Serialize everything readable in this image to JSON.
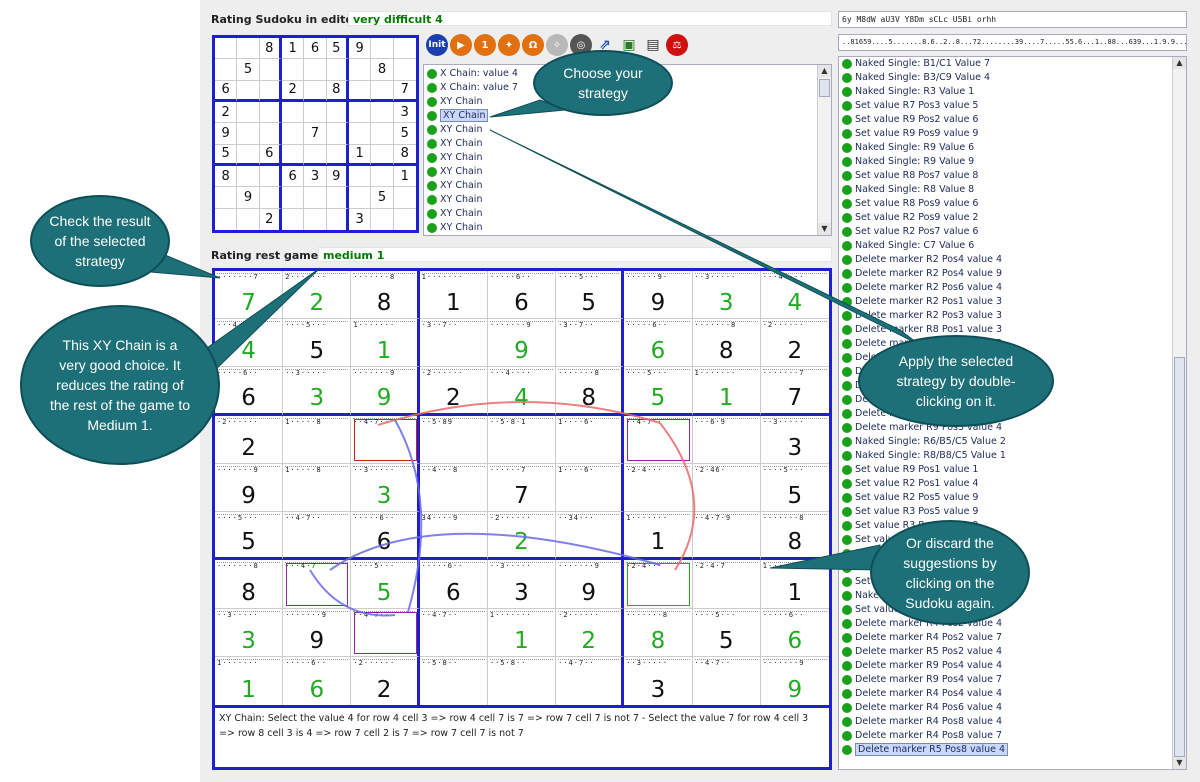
{
  "editor": {
    "rating_label": "Rating Sudoku in editor:",
    "rating_value": "very difficult 4"
  },
  "rest": {
    "rating_label": "Rating rest game:",
    "rating_value": "medium 1"
  },
  "top_inputs": {
    "code1": "6y M8dW aU3V Y8Dm sCLc U5Bi orhh",
    "code2": "..81659....5.......8.6..2..8...72........39....7.....55.6...1..88...639...1.9.9...."
  },
  "toolbar": {
    "init_label": "Init",
    "icons": [
      "init-icon",
      "play-icon",
      "one-step-icon",
      "runner-icon",
      "omega-icon",
      "walker-icon",
      "globe-icon",
      "export-icon",
      "camera-icon",
      "print-icon",
      "scale-icon"
    ]
  },
  "strategies": [
    "X Chain: value 4",
    "X Chain: value 7",
    "XY Chain",
    "XY Chain",
    "XY Chain",
    "XY Chain",
    "XY Chain",
    "XY Chain",
    "XY Chain",
    "XY Chain",
    "XY Chain",
    "XY Chain",
    "XY Chain"
  ],
  "selected_strategy_index": 3,
  "small_grid": [
    [
      "",
      "",
      "8",
      "1",
      "6",
      "5",
      "9",
      "",
      ""
    ],
    [
      "",
      "5",
      "",
      "",
      "",
      "",
      "",
      "8",
      ""
    ],
    [
      "6",
      "",
      "",
      "2",
      "",
      "8",
      "",
      "",
      "7"
    ],
    [
      "2",
      "",
      "",
      "",
      "",
      "",
      "",
      "",
      "3"
    ],
    [
      "9",
      "",
      "",
      "",
      "7",
      "",
      "",
      "",
      "5"
    ],
    [
      "5",
      "",
      "6",
      "",
      "",
      "",
      "1",
      "",
      "8"
    ],
    [
      "8",
      "",
      "",
      "6",
      "3",
      "9",
      "",
      "",
      "1"
    ],
    [
      "",
      "9",
      "",
      "",
      "",
      "",
      "",
      "5",
      ""
    ],
    [
      "",
      "",
      "2",
      "",
      "",
      "",
      "3",
      "",
      ""
    ]
  ],
  "big_grid": [
    [
      [
        "7",
        "g",
        "·······7"
      ],
      [
        "2",
        "g",
        "2·······"
      ],
      [
        "8",
        "k",
        "·······8"
      ],
      [
        "1",
        "k",
        "1·······"
      ],
      [
        "6",
        "k",
        "·····6··"
      ],
      [
        "5",
        "k",
        "····5···"
      ],
      [
        "9",
        "k",
        "······9·"
      ],
      [
        "3",
        "g",
        "··3·····"
      ],
      [
        "4",
        "g",
        "···4····"
      ]
    ],
    [
      [
        "4",
        "g",
        "···4····"
      ],
      [
        "5",
        "k",
        "····5···"
      ],
      [
        "1",
        "g",
        "1·······"
      ],
      [
        "",
        "k",
        "·3··7··"
      ],
      [
        "9",
        "g",
        "·······9"
      ],
      [
        "",
        "k",
        "·3··7··"
      ],
      [
        "6",
        "g",
        "·····6··"
      ],
      [
        "8",
        "k",
        "·······8"
      ],
      [
        "2",
        "k",
        "·2······"
      ]
    ],
    [
      [
        "6",
        "k",
        "·····6··"
      ],
      [
        "3",
        "g",
        "··3·····"
      ],
      [
        "9",
        "g",
        "·······9"
      ],
      [
        "2",
        "k",
        "·2······"
      ],
      [
        "4",
        "g",
        "···4····"
      ],
      [
        "8",
        "k",
        "·······8"
      ],
      [
        "5",
        "g",
        "····5···"
      ],
      [
        "1",
        "g",
        "1·······"
      ],
      [
        "7",
        "k",
        "·······7"
      ]
    ],
    [
      [
        "2",
        "k",
        "·2······"
      ],
      [
        "",
        "k",
        "1·····8"
      ],
      [
        "",
        "k",
        "··4·7··"
      ],
      [
        "",
        "k",
        "··5·89"
      ],
      [
        "",
        "k",
        "··5·8·1"
      ],
      [
        "",
        "k",
        "1····6·"
      ],
      [
        "",
        "k",
        "··4·7··"
      ],
      [
        "",
        "k",
        "···6·9"
      ],
      [
        "3",
        "k",
        "··3·····"
      ]
    ],
    [
      [
        "9",
        "k",
        "·······9"
      ],
      [
        "",
        "k",
        "1·····8"
      ],
      [
        "3",
        "g",
        "··3·····"
      ],
      [
        "",
        "k",
        "··4···8"
      ],
      [
        "7",
        "k",
        "······7"
      ],
      [
        "",
        "k",
        "1····6·"
      ],
      [
        "",
        "k",
        "·2·4···"
      ],
      [
        "",
        "k",
        "·2·46·"
      ],
      [
        "5",
        "k",
        "····5···"
      ]
    ],
    [
      [
        "5",
        "k",
        "····5···"
      ],
      [
        "",
        "k",
        "··4·7··"
      ],
      [
        "6",
        "k",
        "·····6··"
      ],
      [
        "",
        "k",
        "34····9"
      ],
      [
        "2",
        "g",
        "·2······"
      ],
      [
        "",
        "k",
        "··34···"
      ],
      [
        "1",
        "k",
        "1·······"
      ],
      [
        "",
        "k",
        "··4·7·9"
      ],
      [
        "8",
        "k",
        "·······8"
      ]
    ],
    [
      [
        "8",
        "k",
        "·······8"
      ],
      [
        "",
        "k",
        "···4·7"
      ],
      [
        "5",
        "g",
        "····5···"
      ],
      [
        "6",
        "k",
        "·····6··"
      ],
      [
        "3",
        "k",
        "··3·····"
      ],
      [
        "9",
        "k",
        "·······9"
      ],
      [
        "",
        "k",
        "·2·4···"
      ],
      [
        "",
        "k",
        "·2·4·7"
      ],
      [
        "1",
        "k",
        "1·······"
      ]
    ],
    [
      [
        "3",
        "g",
        "··3·····"
      ],
      [
        "9",
        "k",
        "·······9"
      ],
      [
        "",
        "k",
        "··4·7··"
      ],
      [
        "",
        "k",
        "··4·7··"
      ],
      [
        "1",
        "g",
        "1·······"
      ],
      [
        "2",
        "g",
        "·2······"
      ],
      [
        "8",
        "g",
        "·······8"
      ],
      [
        "5",
        "k",
        "····5···"
      ],
      [
        "6",
        "g",
        "·····6··"
      ]
    ],
    [
      [
        "1",
        "g",
        "1·······"
      ],
      [
        "6",
        "g",
        "·····6··"
      ],
      [
        "2",
        "k",
        "·2······"
      ],
      [
        "",
        "k",
        "··5·8··"
      ],
      [
        "",
        "k",
        "··5·8··"
      ],
      [
        "",
        "k",
        "··4·7··"
      ],
      [
        "3",
        "k",
        "··3·····"
      ],
      [
        "",
        "k",
        "··4·7··"
      ],
      [
        "9",
        "g",
        "·······9"
      ]
    ]
  ],
  "explanation": "XY Chain: Select the value 4 for row 4 cell 3 => row 4 cell 7 is 7 => row 7 cell 7 is not 7 - Select the value 7 for row 4 cell 3 => row 8 cell 3 is 4 => row 7 cell 2 is 7 => row 7 cell 7 is not 7",
  "steps": [
    "Naked Single: B1/C1 Value 7",
    "Naked Single: B3/C9 Value 4",
    "Naked Single: R3 Value 1",
    "Set value R7 Pos3 value 5",
    "Set value R9 Pos2 value 6",
    "Set value R9 Pos9 value 9",
    "Naked Single: R9 Value 6",
    "Naked Single: R9 Value 9",
    "Set value R8 Pos7 value 8",
    "Naked Single: R8 Value 8",
    "Set value R8 Pos9 value 6",
    "Set value R2 Pos9 value 2",
    "Set value R2 Pos7 value 6",
    "Naked Single: C7 Value 6",
    "Delete marker R2 Pos4 value 4",
    "Delete marker R2 Pos4 value 9",
    "Delete marker R2 Pos6 value 4",
    "Delete marker R2 Pos1 value 3",
    "Delete marker R2 Pos3 value 3",
    "Delete marker R8 Pos1 value 3",
    "Delete marker R8 Pos1 value 3",
    "Delete marker R8 Pos1 value 3",
    "Delete marker R8 Pos1 value 3",
    "Delete marker R8 Pos1 value 3",
    "Delete marker R8 Pos1 value 3",
    "Delete marker R8 Pos1 value 3",
    "Delete marker R9 Pos3 value 4",
    "Naked Single: R6/B5/C5 Value 2",
    "Naked Single: R8/B8/C5 Value 1",
    "Set value R9 Pos1 value 1",
    "Set value R2 Pos1 value 4",
    "Set value R2 Pos5 value 9",
    "Set value R3 Pos5 value 9",
    "Set value R3 Pos5 value 9",
    "Set value R3 Pos5 value 9",
    "Set value R3 Pos5 value 9",
    "Naked Single: R3 Value 9",
    "Set value R8 Pos1 value 3",
    "Naked Single: R3 Value 9",
    "Set value R8 Pos1 value 3",
    "Delete marker R4 Pos2 value 4",
    "Delete marker R4 Pos2 value 7",
    "Delete marker R5 Pos2 value 4",
    "Delete marker R9 Pos4 value 4",
    "Delete marker R9 Pos4 value 7",
    "Delete marker R4 Pos4 value 4",
    "Delete marker R4 Pos6 value 4",
    "Delete marker R4 Pos8 value 4",
    "Delete marker R4 Pos8 value 7",
    "Delete marker R5 Pos8 value 4"
  ],
  "callouts": {
    "choose": "Choose your strategy",
    "check": "Check the result of the selected strategy",
    "xy": "This XY Chain is a very good choice. It reduces the rating of the rest of the game to Medium 1.",
    "apply": "Apply the selected strategy by double-clicking on it.",
    "discard": "Or discard the suggestions by clicking on the Sudoku again."
  },
  "colors": {
    "accent": "#1f1fd0",
    "given_green": "#22aa22",
    "bubble": "#1d6f78"
  }
}
